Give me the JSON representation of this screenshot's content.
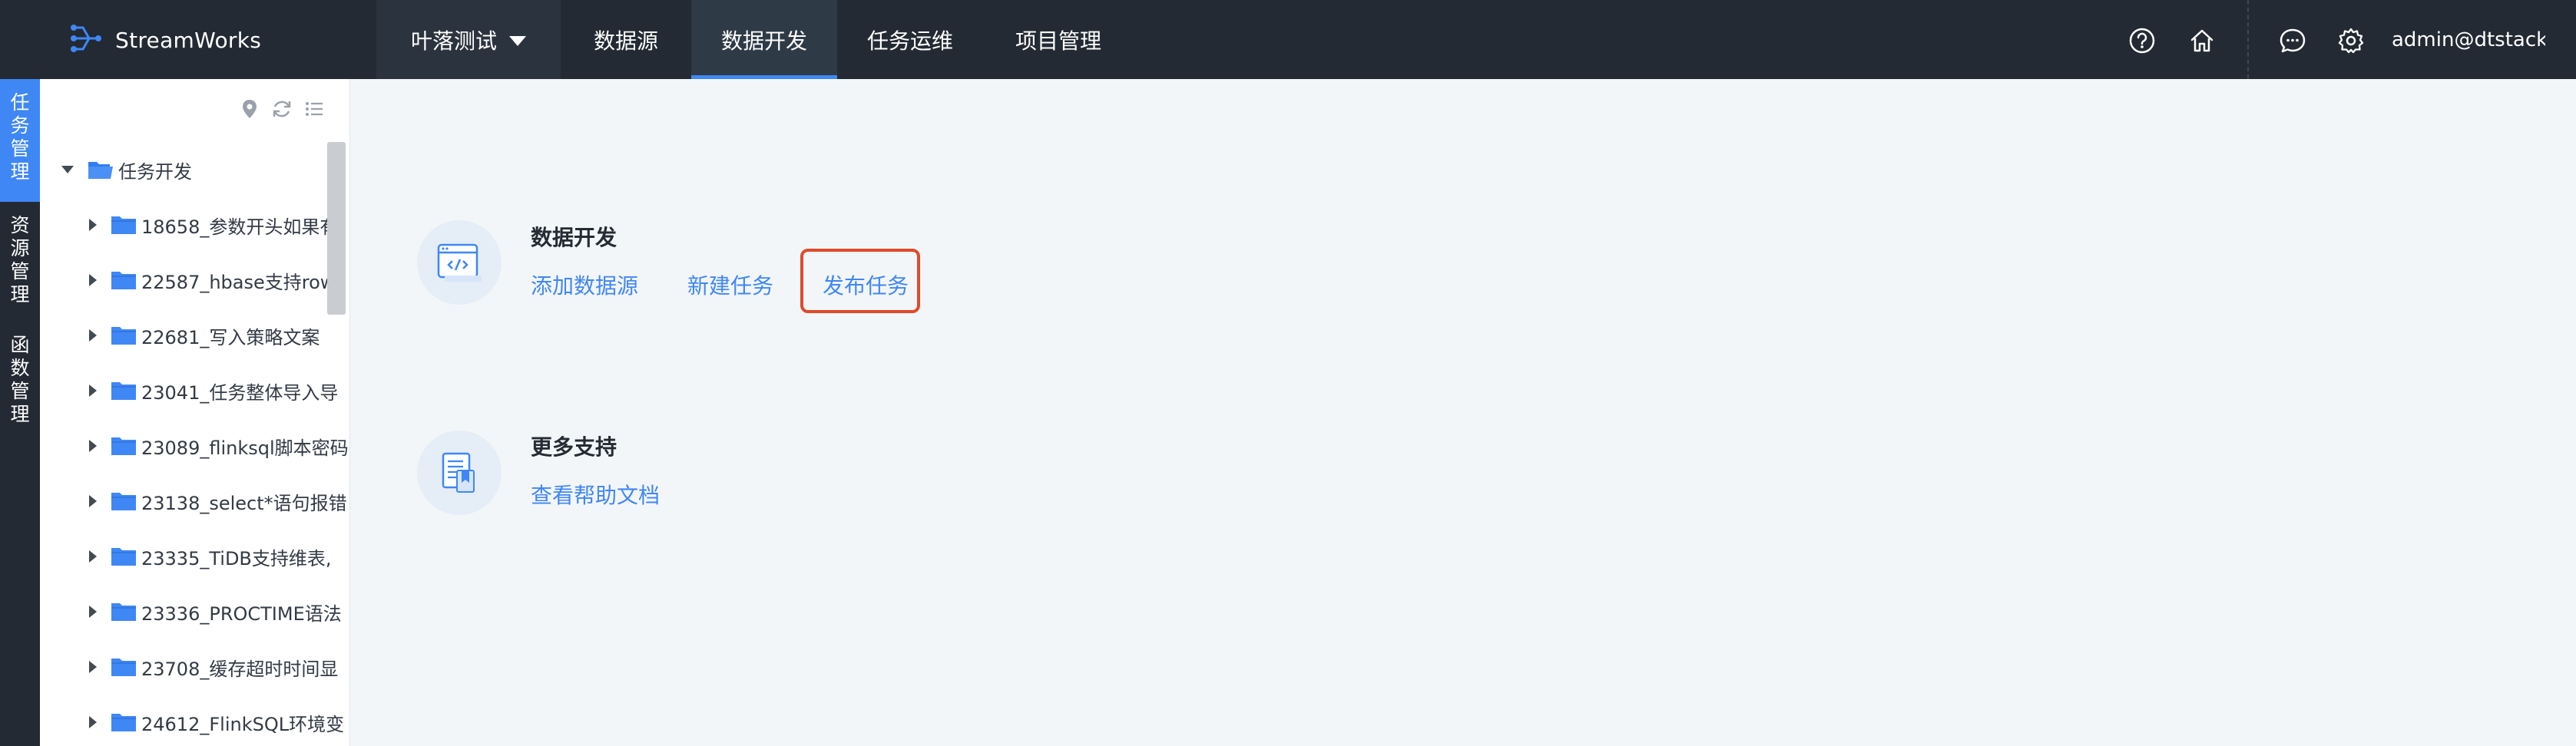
{
  "app": {
    "brand": "StreamWorks",
    "project": "叶落测试",
    "user": "admin@dtstack..."
  },
  "nav": {
    "items": [
      {
        "label": "数据源",
        "active": false
      },
      {
        "label": "数据开发",
        "active": true
      },
      {
        "label": "任务运维",
        "active": false
      },
      {
        "label": "项目管理",
        "active": false
      }
    ]
  },
  "header_icons": [
    "help-icon",
    "home-icon",
    "message-icon",
    "settings-icon"
  ],
  "side_tabs": [
    {
      "label": "任务管理",
      "active": true
    },
    {
      "label": "资源管理",
      "active": false
    },
    {
      "label": "函数管理",
      "active": false
    }
  ],
  "tree": {
    "toolbar_icons": [
      "locate-icon",
      "refresh-icon",
      "list-icon"
    ],
    "root": "任务开发",
    "items": [
      "18658_参数开头如果有",
      "22587_hbase支持row",
      "22681_写入策略文案",
      "23041_任务整体导入导",
      "23089_flinksql脚本密码",
      "23138_select*语句报错",
      "23335_TiDB支持维表,",
      "23336_PROCTIME语法",
      "23708_缓存超时时间显",
      "24612_FlinkSQL环境变"
    ]
  },
  "main": {
    "dev_section": {
      "title": "数据开发",
      "links": [
        "添加数据源",
        "新建任务",
        "发布任务"
      ]
    },
    "support_section": {
      "title": "更多支持",
      "links": [
        "查看帮助文档"
      ]
    }
  },
  "colors": {
    "topbar": "#232a33",
    "accent": "#3f87f5",
    "highlight": "#e04a2a",
    "background": "#f3f6f9"
  }
}
